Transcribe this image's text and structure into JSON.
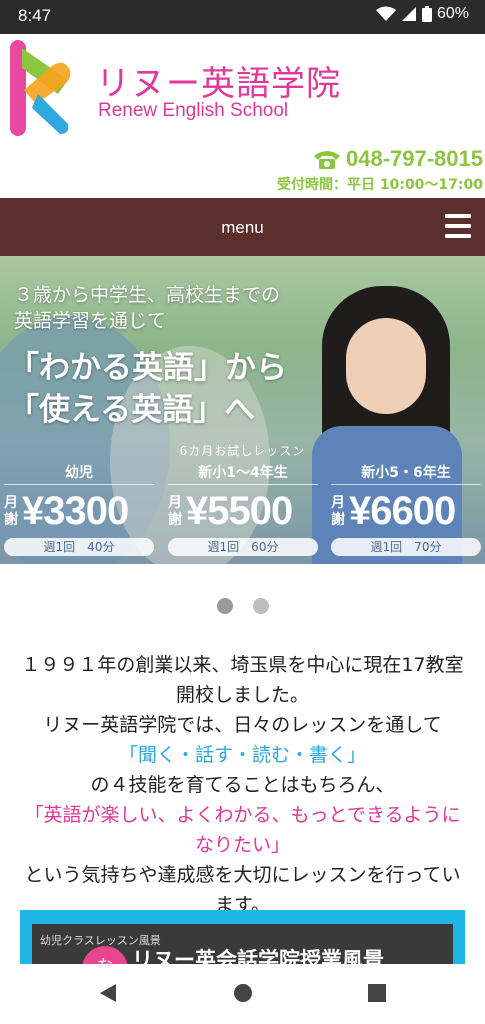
{
  "status_bar": {
    "time": "8:47",
    "battery": "60%"
  },
  "header": {
    "brand_jp": "リヌー英語学院",
    "brand_en": "Renew English School",
    "phone": "048-797-8015",
    "hours": "受付時間：平日 10:00〜17:00"
  },
  "menu": {
    "label": "menu"
  },
  "hero": {
    "line1": "３歳から中学生、高校生までの",
    "line2": "英語学習を通じて",
    "line3": "「わかる英語」から",
    "line4": "「使える英語」へ",
    "trial": "6カ月お試しレッスン",
    "cards": [
      {
        "level": "幼児",
        "monthly": "月謝",
        "amount": "¥3300",
        "freq": "週1回　40分"
      },
      {
        "level": "新小1〜4年生",
        "monthly": "月謝",
        "amount": "¥5500",
        "freq": "週1回　60分"
      },
      {
        "level": "新小5・6年生",
        "monthly": "月謝",
        "amount": "¥6600",
        "freq": "週1回　70分"
      }
    ]
  },
  "intro": {
    "p1": "１９９１年の創業以来、埼玉県を中心に現在17教室開校しました。",
    "p2": "リヌー英語学院では、日々のレッスンを通して",
    "skills": "「聞く・話す・読む・書く」",
    "p3": "の４技能を育てることはもちろん、",
    "goal": "「英語が楽しい、よくわかる、もっとできるようになりたい」",
    "p4": "という気持ちや達成感を大切にレッスンを行っています。"
  },
  "video": {
    "title": "リヌー英会話学院授業風景",
    "subtitle": "幼児クラスレッスン風景",
    "badge": "な"
  },
  "colors": {
    "brand_pink": "#e0389b",
    "phone_green": "#8cc63e",
    "menu_brown": "#5a2f2d",
    "video_cyan": "#1fb5e6"
  }
}
